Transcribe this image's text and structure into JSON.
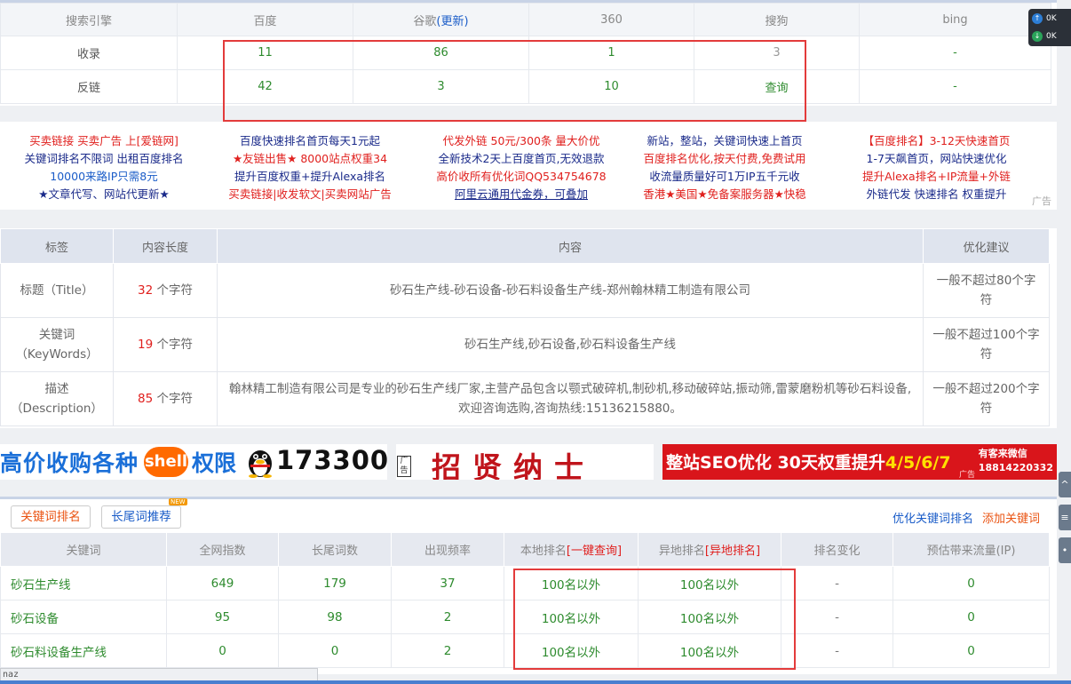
{
  "search_engines": {
    "headers": [
      "搜索引擎",
      "百度",
      "谷歌",
      "360",
      "搜狗",
      "bing"
    ],
    "google_update_link": "(更新)",
    "rows": [
      {
        "label": "收录",
        "values": [
          "11",
          "86",
          "1",
          "3",
          "-"
        ]
      },
      {
        "label": "反链",
        "values": [
          "42",
          "3",
          "10",
          "查询",
          "-"
        ]
      }
    ]
  },
  "text_ads": {
    "col1": [
      "买卖链接 买卖广告 上[爱链网]",
      "关键词排名不限词 出租百度排名",
      "10000来路IP只需8元",
      "★文章代写、网站代更新★"
    ],
    "col2": [
      "百度快速排名首页每天1元起",
      "★友链出售★ 8000站点权重34",
      "提升百度权重+提升Alexa排名",
      "买卖链接|收发软文|买卖网站广告"
    ],
    "col3": [
      "代发外链 50元/300条 量大价优",
      "全新技术2天上百度首页,无效退款",
      "高价收所有优化词QQ534754678",
      "阿里云通用代金券，可叠加"
    ],
    "col4": [
      "新站，整站，关键词快速上首页",
      "百度排名优化,按天付费,免费试用",
      "收流量质量好可1万IP五千元收",
      "香港★美国★免备案服务器★快稳"
    ],
    "col5": [
      "【百度排名】3-12天快速首页",
      "1-7天飙首页，网站快速优化",
      "提升Alexa排名+IP流量+外链",
      "外链代发 快速排名 权重提升"
    ],
    "tag": "广告"
  },
  "meta": {
    "headers": [
      "标签",
      "内容长度",
      "内容",
      "优化建议"
    ],
    "rows": [
      {
        "label": "标题（Title）",
        "count": "32",
        "unit": " 个字符",
        "content": "砂石生产线-砂石设备-砂石料设备生产线-郑州翰林精工制造有限公司",
        "advice": "一般不超过80个字符"
      },
      {
        "label": "关键词（KeyWords）",
        "count": "19",
        "unit": " 个字符",
        "content": "砂石生产线,砂石设备,砂石料设备生产线",
        "advice": "一般不超过100个字符"
      },
      {
        "label": "描述（Description）",
        "count": "85",
        "unit": " 个字符",
        "content": "翰林精工制造有限公司是专业的砂石生产线厂家,主营产品包含以颚式破碎机,制砂机,移动破碎站,振动筛,雷蒙磨粉机等砂石料设备,欢迎咨询选购,咨询热线:15136215880。",
        "advice": "一般不超过200个字符"
      }
    ]
  },
  "banners": {
    "b1_text1": "高价收购各种",
    "b1_shell": "shell",
    "b1_text2": "权限",
    "b1_number": "173300",
    "b2_text": "招贤纳士",
    "b2_tag": "广告",
    "b3_text_a": "整站SEO优化",
    "b3_text_b": " 30天权重提升",
    "b3_text_c": "4/5/6/7",
    "b3_wx1": "有客来微信",
    "b3_wx2": "18814220332",
    "b3_tag": "广告"
  },
  "keywords": {
    "tab_active": "关键词排名",
    "tab_other": "长尾词推荐",
    "new_badge": "NEW",
    "optimize_link": "优化关键词排名",
    "add_link": "添加关键词",
    "headers": [
      "关键词",
      "全网指数",
      "长尾词数",
      "出现频率",
      "本地排名",
      "异地排名",
      "排名变化",
      "预估带来流量(IP)"
    ],
    "local_query": "[一键查询]",
    "remote_query": "[异地排名]",
    "rows": [
      {
        "kw": "砂石生产线",
        "index": "649",
        "longtail": "179",
        "freq": "37",
        "local": "100名以外",
        "remote": "100名以外",
        "change": "-",
        "traffic": "0"
      },
      {
        "kw": "砂石设备",
        "index": "95",
        "longtail": "98",
        "freq": "2",
        "local": "100名以外",
        "remote": "100名以外",
        "change": "-",
        "traffic": "0"
      },
      {
        "kw": "砂石料设备生产线",
        "index": "0",
        "longtail": "0",
        "freq": "2",
        "local": "100名以外",
        "remote": "100名以外",
        "change": "-",
        "traffic": "0"
      }
    ]
  },
  "net_speed": {
    "up": "0K",
    "down": "0K"
  },
  "side_buttons": [
    "^",
    "≡",
    "•"
  ],
  "status_text": "naz",
  "colors": {
    "accent_red": "#e0201e",
    "value_green": "#2e8b2e",
    "link_blue": "#1a5cc8",
    "highlight_box": "#e33b3b"
  }
}
